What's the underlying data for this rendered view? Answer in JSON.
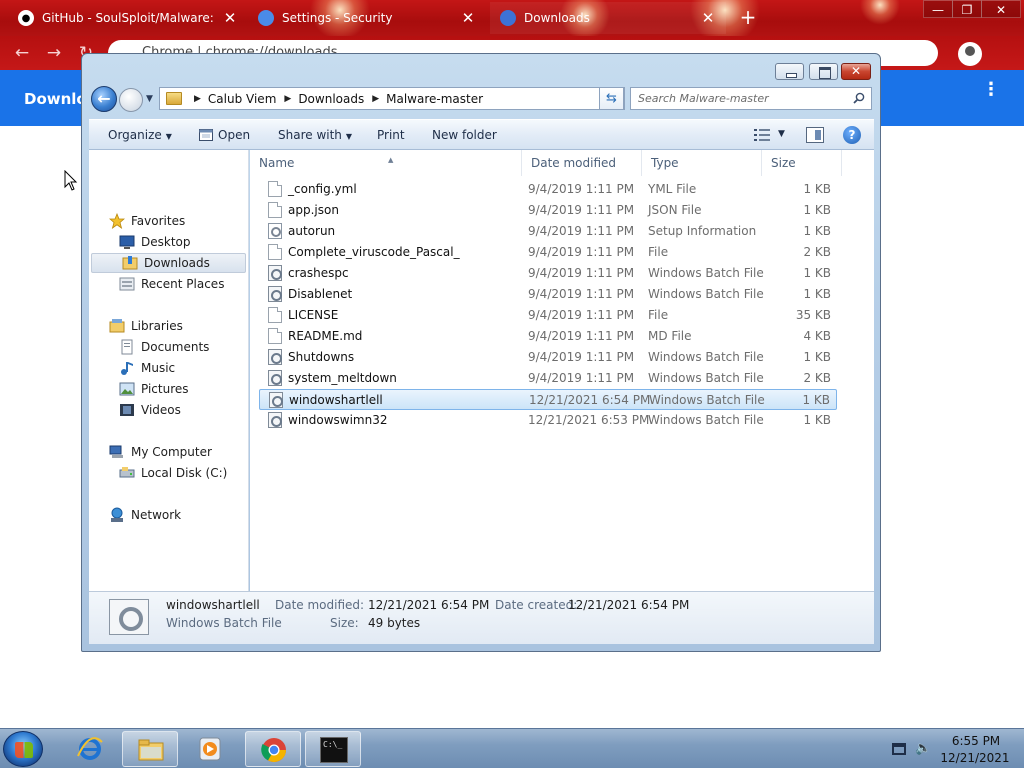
{
  "browser": {
    "tabs": [
      {
        "label": "GitHub - SoulSploit/Malware: Be",
        "close": "✕"
      },
      {
        "label": "Settings - Security",
        "close": "✕"
      },
      {
        "label": "Downloads",
        "close": "✕"
      }
    ],
    "new_tab": "+",
    "window_controls": {
      "minimize": "—",
      "maximize": "❐",
      "close": "✕"
    },
    "nav": {
      "back": "←",
      "forward": "→",
      "reload": "↻"
    },
    "omnibox_text": "Chrome  |  chrome://downloads",
    "downloads_title": "Downloa",
    "menu": "⋮"
  },
  "explorer": {
    "breadcrumb": [
      "Calub Viem",
      "Downloads",
      "Malware-master"
    ],
    "crumb_sep": "▶",
    "address_dropdown": "▼",
    "refresh": "⇆",
    "back": "←",
    "recent_arrow": "▼",
    "search_placeholder": "Search Malware-master",
    "close_glyph": "✕",
    "commands": {
      "organize": "Organize",
      "open": "Open",
      "share_with": "Share with",
      "print": "Print",
      "new_folder": "New folder",
      "dropdown": "▼",
      "help": "?"
    },
    "nav_pane": {
      "favorites": "Favorites",
      "desktop": "Desktop",
      "downloads": "Downloads",
      "recent_places": "Recent Places",
      "libraries": "Libraries",
      "documents": "Documents",
      "music": "Music",
      "pictures": "Pictures",
      "videos": "Videos",
      "my_computer": "My Computer",
      "local_disk": "Local Disk (C:)",
      "network": "Network"
    },
    "columns": {
      "name": "Name",
      "date_modified": "Date modified",
      "type": "Type",
      "size": "Size",
      "sort_indicator": "▲"
    },
    "files": [
      {
        "name": "_config.yml",
        "date": "9/4/2019 1:11 PM",
        "type": "YML File",
        "size": "1 KB",
        "icon": "doc"
      },
      {
        "name": "app.json",
        "date": "9/4/2019 1:11 PM",
        "type": "JSON File",
        "size": "1 KB",
        "icon": "doc"
      },
      {
        "name": "autorun",
        "date": "9/4/2019 1:11 PM",
        "type": "Setup Information",
        "size": "1 KB",
        "icon": "inf"
      },
      {
        "name": "Complete_viruscode_Pascal_",
        "date": "9/4/2019 1:11 PM",
        "type": "File",
        "size": "2 KB",
        "icon": "doc"
      },
      {
        "name": "crashespc",
        "date": "9/4/2019 1:11 PM",
        "type": "Windows Batch File",
        "size": "1 KB",
        "icon": "bat"
      },
      {
        "name": "Disablenet",
        "date": "9/4/2019 1:11 PM",
        "type": "Windows Batch File",
        "size": "1 KB",
        "icon": "bat"
      },
      {
        "name": "LICENSE",
        "date": "9/4/2019 1:11 PM",
        "type": "File",
        "size": "35 KB",
        "icon": "doc"
      },
      {
        "name": "README.md",
        "date": "9/4/2019 1:11 PM",
        "type": "MD File",
        "size": "4 KB",
        "icon": "doc"
      },
      {
        "name": "Shutdowns",
        "date": "9/4/2019 1:11 PM",
        "type": "Windows Batch File",
        "size": "1 KB",
        "icon": "bat"
      },
      {
        "name": "system_meltdown",
        "date": "9/4/2019 1:11 PM",
        "type": "Windows Batch File",
        "size": "2 KB",
        "icon": "bat"
      },
      {
        "name": "windowshartlell",
        "date": "12/21/2021 6:54 PM",
        "type": "Windows Batch File",
        "size": "1 KB",
        "icon": "bat",
        "selected": true
      },
      {
        "name": "windowswimn32",
        "date": "12/21/2021 6:53 PM",
        "type": "Windows Batch File",
        "size": "1 KB",
        "icon": "bat"
      }
    ],
    "details": {
      "name": "windowshartlell",
      "type": "Windows Batch File",
      "modified_label": "Date modified:",
      "modified_value": "12/21/2021 6:54 PM",
      "created_label": "Date created:",
      "created_value": "12/21/2021 6:54 PM",
      "size_label": "Size:",
      "size_value": "49 bytes"
    }
  },
  "taskbar": {
    "cmd_prompt": "C:\\_",
    "volume": "🔈",
    "time": "6:55 PM",
    "date": "12/21/2021"
  },
  "colors": {
    "chrome_tabstrip": "#b51010",
    "downloads_header": "#1a73e8",
    "selection_border": "#7eb4ea"
  }
}
